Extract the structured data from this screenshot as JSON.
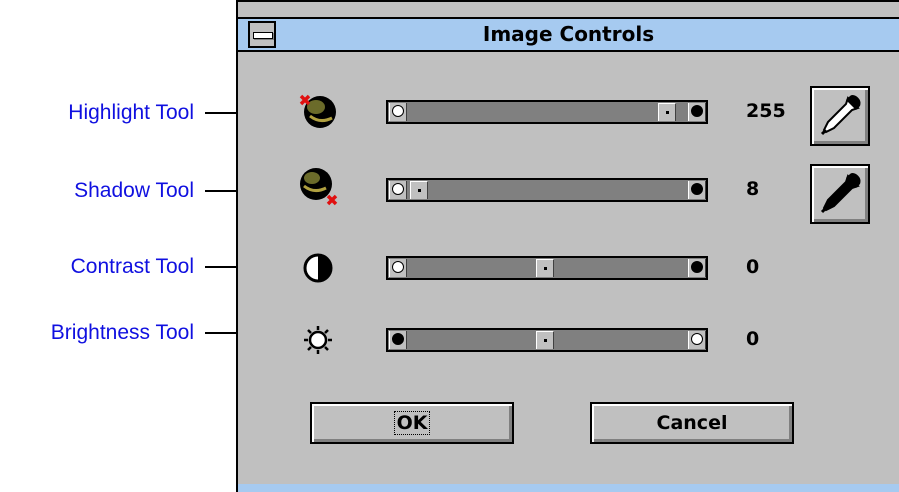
{
  "callouts": [
    {
      "label": "Highlight Tool"
    },
    {
      "label": "Shadow Tool"
    },
    {
      "label": "Contrast Tool"
    },
    {
      "label": "Brightness Tool"
    }
  ],
  "window": {
    "title": "Image Controls"
  },
  "rows": [
    {
      "name": "highlight",
      "icon": "highlight-tool-icon",
      "value": "255",
      "slider_position": 0.94,
      "left_end": "white-circle",
      "right_end": "black-circle"
    },
    {
      "name": "shadow",
      "icon": "shadow-tool-icon",
      "value": "8",
      "slider_position": 0.03,
      "left_end": "white-circle",
      "right_end": "black-circle"
    },
    {
      "name": "contrast",
      "icon": "contrast-tool-icon",
      "value": "0",
      "slider_position": 0.5,
      "left_end": "white-circle",
      "right_end": "black-circle"
    },
    {
      "name": "brightness",
      "icon": "brightness-tool-icon",
      "value": "0",
      "slider_position": 0.5,
      "left_end": "black-circle",
      "right_end": "white-circle"
    }
  ],
  "buttons": {
    "ok": "OK",
    "cancel": "Cancel"
  },
  "colors": {
    "titlebar": "#a6caf0",
    "dialog_bg": "#c0c0c0",
    "callout_text": "#1010e0"
  }
}
